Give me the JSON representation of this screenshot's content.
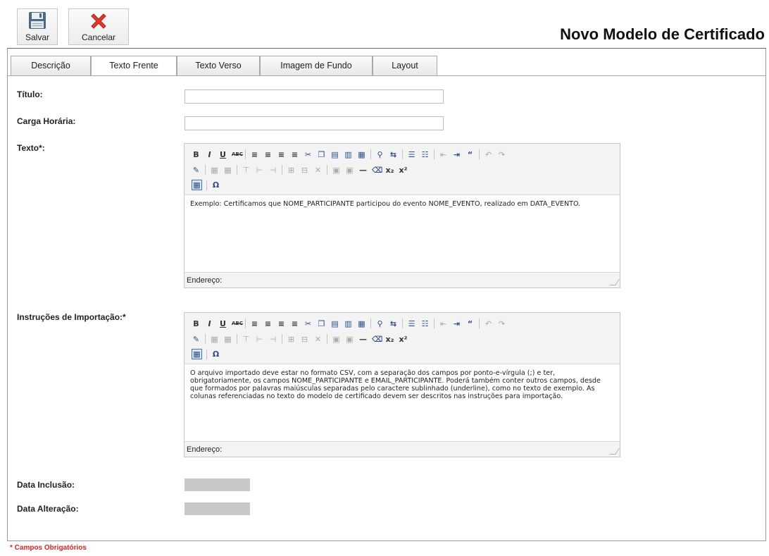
{
  "toolbar": {
    "save_label": "Salvar",
    "cancel_label": "Cancelar"
  },
  "page": {
    "title": "Novo Modelo de Certificado"
  },
  "tabs": [
    {
      "label": "Descrição"
    },
    {
      "label": "Texto Frente"
    },
    {
      "label": "Texto Verso"
    },
    {
      "label": "Imagem de Fundo"
    },
    {
      "label": "Layout"
    }
  ],
  "active_tab": "Texto Frente",
  "form": {
    "titulo_label": "Título:",
    "titulo_value": "",
    "carga_label": "Carga Horária:",
    "carga_value": "",
    "texto_label": "Texto*:",
    "texto_content": "Exemplo: Certificamos que NOME_PARTICIPANTE participou do evento NOME_EVENTO, realizado em DATA_EVENTO.",
    "instrucoes_label": "Instruções de Importação:*",
    "instrucoes_content": "O arquivo importado deve estar no formato CSV, com a separação dos campos por ponto-e-vírgula (;) e ter, obrigatoriamente, os campos NOME_PARTICIPANTE e EMAIL_PARTICIPANTE. Poderá também conter outros campos, desde que formados por palavras maiúsculas separadas pelo caractere sublinhado (underline), como no texto de exemplo. As colunas referenciadas no texto do modelo de certificado devem ser descritos nas instruções para importação.",
    "status_label": "Endereço:",
    "data_inclusao_label": "Data Inclusão:",
    "data_alteracao_label": "Data Alteração:"
  },
  "footer": {
    "required_note": "* Campos Obrigatórios"
  },
  "colors": {
    "required": "#dd2222",
    "cancel_icon": "#e03a2f",
    "save_icon": "#4a6a86"
  }
}
